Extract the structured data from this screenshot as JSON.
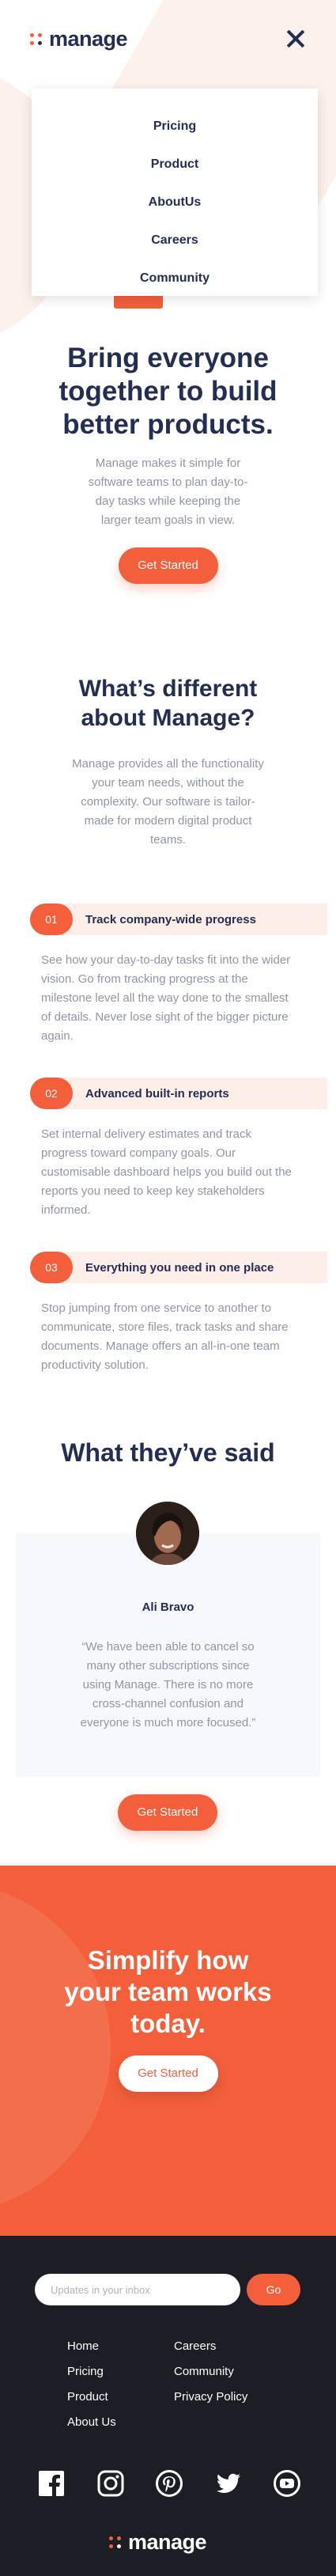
{
  "header": {
    "brand": "manage",
    "nav": [
      "Pricing",
      "Product",
      "AboutUs",
      "Careers",
      "Community"
    ]
  },
  "hero": {
    "title": "Bring everyone together to build better products.",
    "text": "Manage makes it simple for software teams to plan day-to-day tasks while keeping the larger team goals in view.",
    "cta": "Get Started"
  },
  "difference": {
    "title": "What’s different about Manage?",
    "text": "Manage provides all the functionality your team needs, without the complexity. Our software is tailor-made for modern digital product teams.",
    "features": [
      {
        "num": "01",
        "title": "Track company-wide progress",
        "text": "See how your day-to-day tasks fit into the wider vision. Go from tracking progress at the milestone level all the way done to the smallest of details. Never lose sight of the bigger picture again."
      },
      {
        "num": "02",
        "title": "Advanced built-in reports",
        "text": "Set internal delivery estimates and track progress toward company goals. Our customisable dashboard helps you build out the reports you need to keep key stakeholders informed."
      },
      {
        "num": "03",
        "title": "Everything you need in one place",
        "text": "Stop jumping from one service to another to communicate, store files, track tasks and share documents. Manage offers an all-in-one team productivity solution."
      }
    ]
  },
  "testimonials": {
    "title": "What they’ve said",
    "name": "Ali Bravo",
    "quote": "“We have been able to cancel so many other subscriptions since using Manage. There is no more cross-channel confusion and everyone is much more focused.”",
    "cta": "Get Started"
  },
  "cta_banner": {
    "title": "Simplify how your team works today.",
    "button": "Get Started"
  },
  "footer": {
    "subscribe_placeholder": "Updates in your inbox",
    "subscribe_button": "Go",
    "links_col1": [
      "Home",
      "Pricing",
      "Product",
      "About Us"
    ],
    "links_col2": [
      "Careers",
      "Community",
      "Privacy Policy"
    ],
    "socials": [
      "facebook-icon",
      "instagram-icon",
      "pinterest-icon",
      "twitter-icon",
      "youtube-icon"
    ],
    "brand": "manage"
  },
  "colors": {
    "accent": "#f25f3a",
    "dark": "#242d52",
    "footer_bg": "#1d1e25",
    "muted_text": "#9095a7"
  }
}
